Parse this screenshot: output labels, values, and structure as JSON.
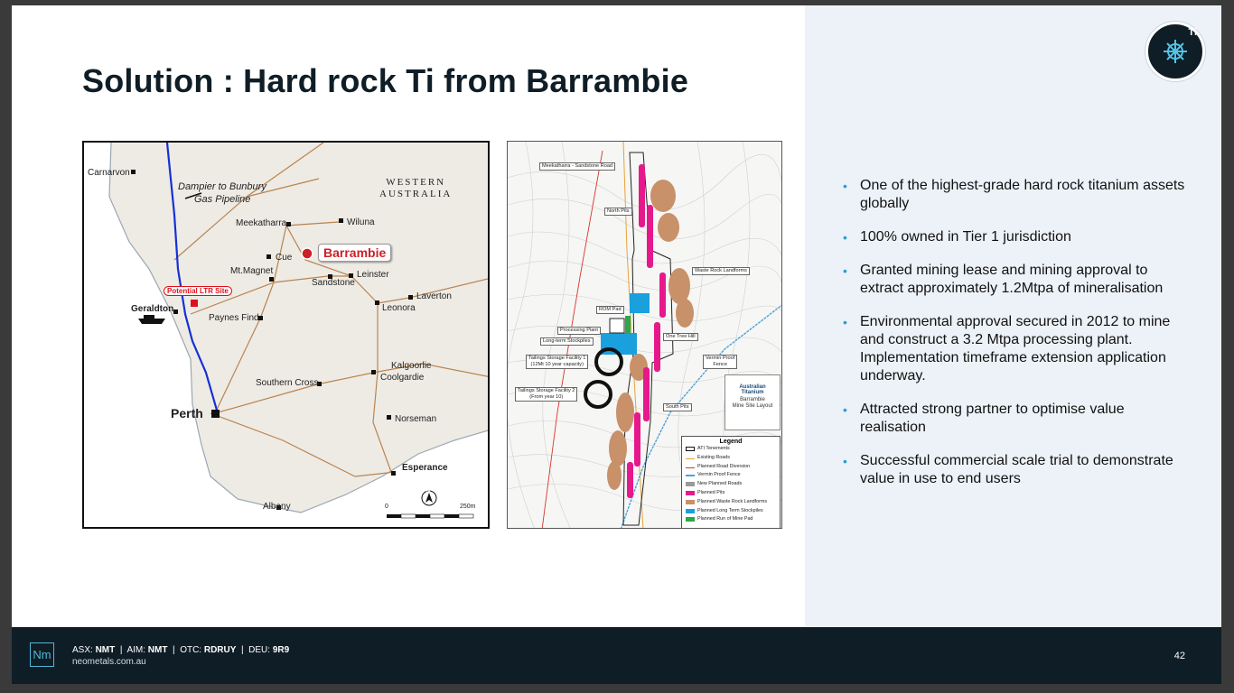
{
  "slide": {
    "title": "Solution : Hard rock Ti from Barrambie",
    "badge_label": "Ti",
    "badge_icon": "ship-wheel-icon"
  },
  "map_wa": {
    "region_label_line1": "WESTERN",
    "region_label_line2": "AUSTRALIA",
    "pipeline_line1": "Dampier to Bunbury",
    "pipeline_line2": "Gas Pipeline",
    "highlight_town": "Barrambie",
    "ltr_site": "Potential LTR Site",
    "towns": {
      "carnarvon": "Carnarvon",
      "meekatharra": "Meekatharra",
      "wiluna": "Wiluna",
      "cue": "Cue",
      "mt_magnet": "Mt.Magnet",
      "sandstone": "Sandstone",
      "leinster": "Leinster",
      "laverton": "Laverton",
      "leonora": "Leonora",
      "geraldton": "Geraldton",
      "paynes_find": "Paynes Find",
      "kalgoorlie": "Kalgoorlie",
      "coolgardie": "Coolgardie",
      "southern_cross": "Southern Cross",
      "perth": "Perth",
      "norseman": "Norseman",
      "esperance": "Esperance",
      "albany": "Albany"
    },
    "scale_start": "0",
    "scale_end": "250m",
    "north_letter": "N"
  },
  "map_site": {
    "labels": {
      "road": "Meekatharra - Sandstone Road",
      "north_pits": "North Pits",
      "waste_rock": "Waste Rock Landforms",
      "rom_pad": "ROM Pad",
      "processing_plant": "Processing Plant",
      "long_term_stockpiles": "Long-term Stockpiles",
      "one_tree_hill": "One Tree Hill",
      "tsf1_line1": "Tailings Storage Facility 1",
      "tsf1_line2": "(12Mt 10 year capacity)",
      "tsf2_line1": "Tailings Storage Facility 2",
      "tsf2_line2": "(From year 10)",
      "vermin_fence_line1": "Vermin Proof",
      "vermin_fence_line2": "Fence",
      "south_pits": "South Pits"
    },
    "title_box": {
      "brand_line1": "Australian",
      "brand_line2": "Titanium",
      "name_line1": "Barrambie",
      "name_line2": "Mine Site Layout"
    },
    "legend": {
      "title": "Legend",
      "items": [
        {
          "label": "ATI Tenements",
          "color": "#ffffff"
        },
        {
          "label": "Existing Roads",
          "color": "#e8a23a"
        },
        {
          "label": "Planned Road Diversion",
          "color": "#d9342b"
        },
        {
          "label": "Vermin Proof Fence",
          "color": "#4aa3d8"
        },
        {
          "label": "New Planned Roads",
          "color": "#9a9a9a"
        },
        {
          "label": "Planned Pits",
          "color": "#e6198c"
        },
        {
          "label": "Planned Waste Rock Landforms",
          "color": "#c8916a"
        },
        {
          "label": "Planned Long Term Stockpiles",
          "color": "#1aa0dc"
        },
        {
          "label": "Planned Run of Mine Pad",
          "color": "#2aa84a"
        }
      ]
    }
  },
  "bullets": [
    "One of the highest-grade hard rock titanium assets globally",
    "100% owned in Tier 1 jurisdiction",
    "Granted mining lease and mining approval to extract approximately 1.2Mtpa of mineralisation",
    "Environmental approval secured in 2012 to mine and construct a 3.2 Mtpa processing plant. Implementation timeframe extension application underway.",
    "Attracted strong partner to optimise value realisation",
    "Successful commercial scale trial to demonstrate value in use to end users"
  ],
  "footer": {
    "logo": "Nm",
    "asx_label": "ASX:",
    "asx_value": "NMT",
    "aim_label": "AIM:",
    "aim_value": "NMT",
    "otc_label": "OTC:",
    "otc_value": "RDRUY",
    "deu_label": "DEU:",
    "deu_value": "9R9",
    "separator": "|",
    "website": "neometals.com.au",
    "page_number": "42"
  },
  "colors": {
    "dark_navy": "#0f1d26",
    "panel": "#edf2f8",
    "accent_blue": "#2a9fd6",
    "highlight_red": "#cc1f26"
  }
}
